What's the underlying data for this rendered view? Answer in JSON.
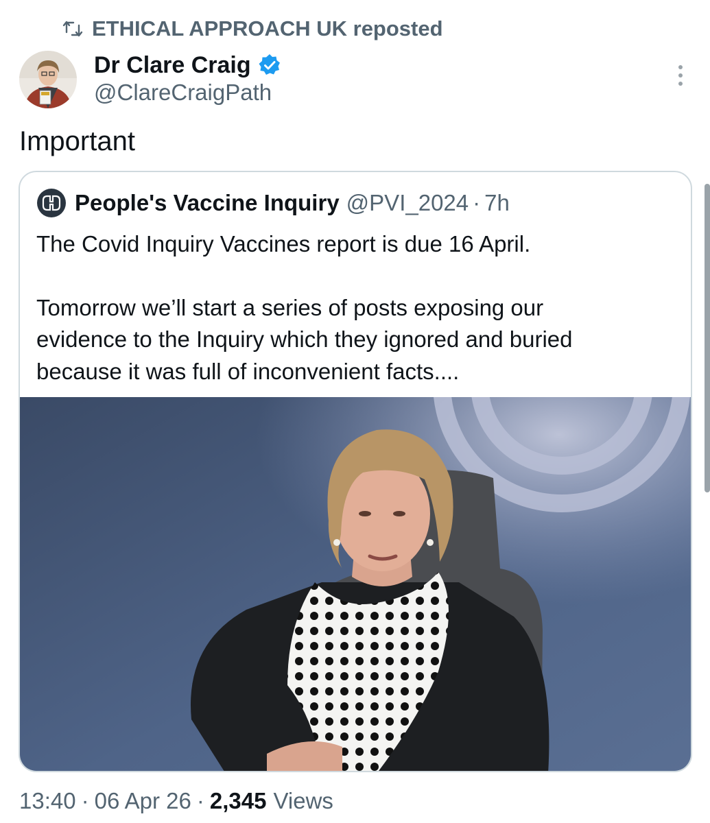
{
  "repost": {
    "icon": "repost-icon",
    "text": "ETHICAL APPROACH UK reposted"
  },
  "author": {
    "name": "Dr Clare Craig",
    "handle": "@ClareCraigPath",
    "verified_icon": "verified-badge-icon",
    "accent": "#1d9bf0"
  },
  "tweet": {
    "text": "Important"
  },
  "quote": {
    "name": "People's Vaccine Inquiry",
    "handle": "@PVI_2024",
    "separator": "·",
    "time": "7h",
    "paragraph1": "The Covid Inquiry Vaccines report is due 16 April.",
    "paragraph2_line1": "Tomorrow we’ll start a series of posts exposing our",
    "paragraph2_line2": "evidence to the Inquiry which they ignored and buried",
    "paragraph2_line3": "because it was full of inconvenient facts....",
    "media": "photo of a woman in a black jacket and polka-dot scarf seated in front of a blue backdrop"
  },
  "meta": {
    "time": "13:40",
    "sep1": "·",
    "date": "06 Apr 26",
    "sep2": "·",
    "views_count": "2,345",
    "views_label": "Views"
  },
  "colors": {
    "text": "#0f1419",
    "secondary": "#536471",
    "border": "#cfd9de"
  }
}
